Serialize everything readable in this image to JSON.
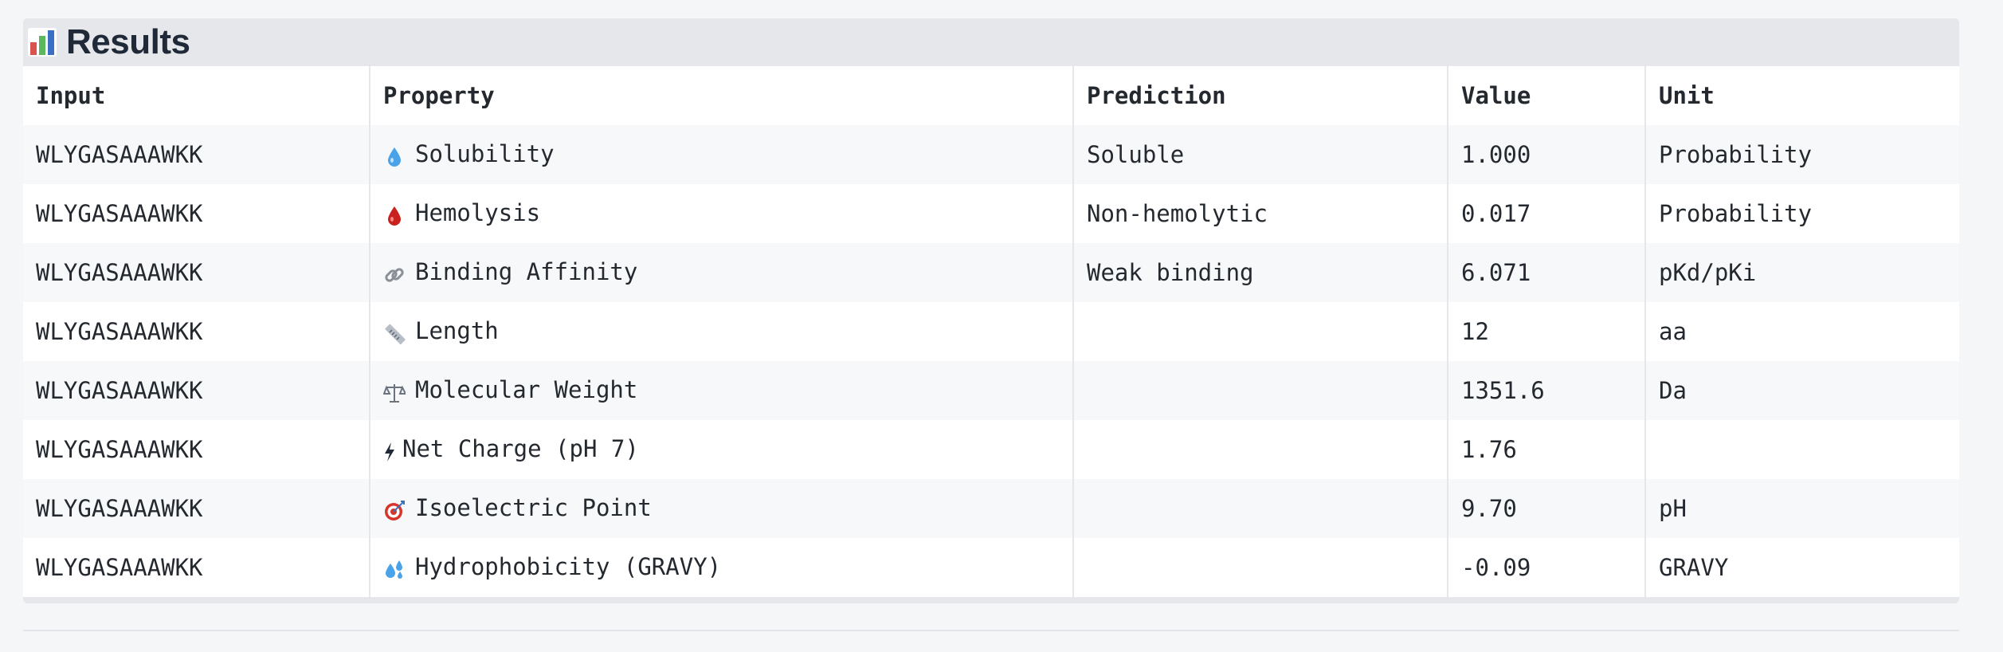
{
  "results": {
    "title": "Results",
    "icon": "bar-chart-icon",
    "columns": [
      "Input",
      "Property",
      "Prediction",
      "Value",
      "Unit"
    ],
    "rows": [
      {
        "input": "WLYGASAAAWKK",
        "icon": "droplet-icon",
        "property": "Solubility",
        "prediction": "Soluble",
        "value": "1.000",
        "unit": "Probability"
      },
      {
        "input": "WLYGASAAAWKK",
        "icon": "blood-drop-icon",
        "property": "Hemolysis",
        "prediction": "Non-hemolytic",
        "value": "0.017",
        "unit": "Probability"
      },
      {
        "input": "WLYGASAAAWKK",
        "icon": "link-icon",
        "property": "Binding Affinity",
        "prediction": "Weak binding",
        "value": "6.071",
        "unit": "pKd/pKi"
      },
      {
        "input": "WLYGASAAAWKK",
        "icon": "ruler-icon",
        "property": "Length",
        "prediction": "",
        "value": "12",
        "unit": "aa"
      },
      {
        "input": "WLYGASAAAWKK",
        "icon": "scales-icon",
        "property": "Molecular Weight",
        "prediction": "",
        "value": "1351.6",
        "unit": "Da"
      },
      {
        "input": "WLYGASAAAWKK",
        "icon": "lightning-icon",
        "property": "Net Charge (pH 7)",
        "prediction": "",
        "value": "1.76",
        "unit": ""
      },
      {
        "input": "WLYGASAAAWKK",
        "icon": "target-icon",
        "property": "Isoelectric Point",
        "prediction": "",
        "value": "9.70",
        "unit": "pH"
      },
      {
        "input": "WLYGASAAAWKK",
        "icon": "water-splash-icon",
        "property": "Hydrophobicity (GRAVY)",
        "prediction": "",
        "value": "-0.09",
        "unit": "GRAVY"
      }
    ]
  }
}
